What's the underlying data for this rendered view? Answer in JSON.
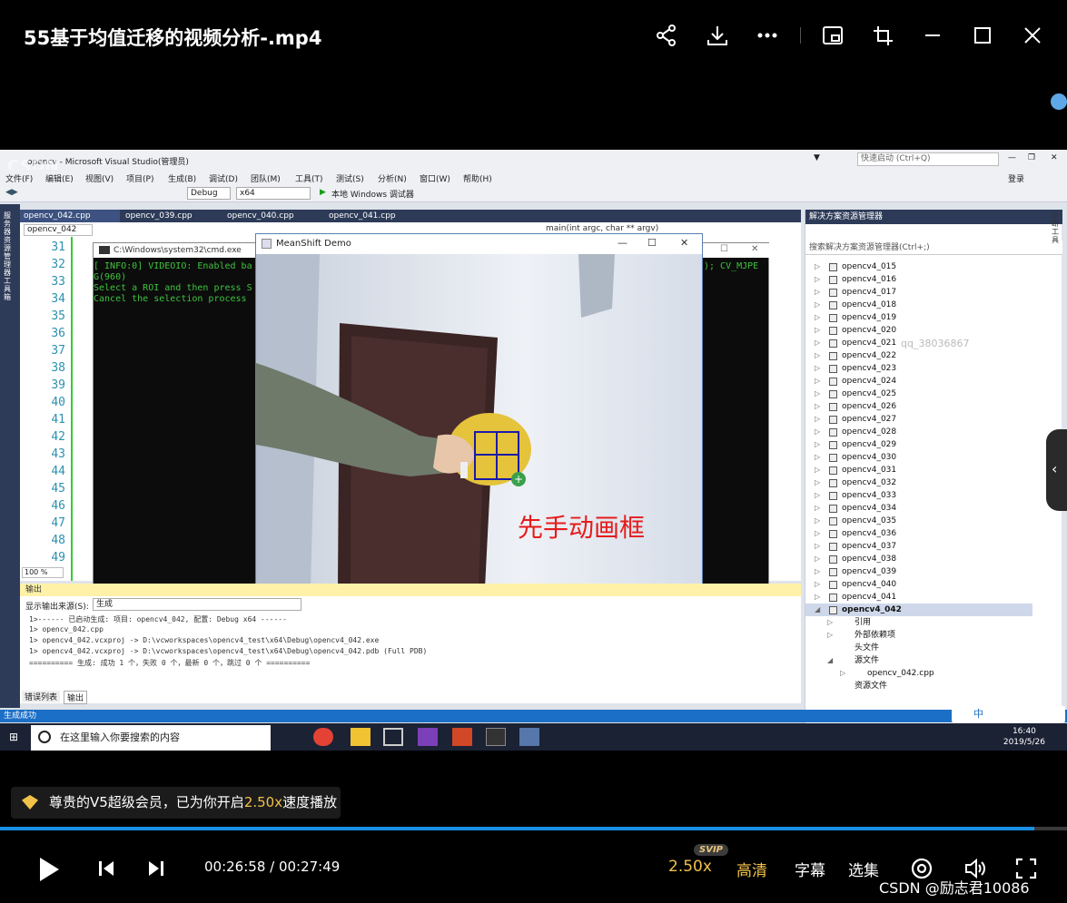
{
  "player": {
    "title": "55基于均值迁移的视频分析-.mp4",
    "vip_prefix": "尊贵的V5超级会员，已为你开启",
    "vip_speed": "2.50x",
    "vip_suffix": "速度播放",
    "time": "00:26:58 / 00:27:49",
    "progress": 0.969,
    "speed": "2.50x",
    "svip_badge": "SVIP",
    "quality": "高清",
    "subtitles": "字幕",
    "episodes": "选集",
    "watermark": "CSDN @励志君10086",
    "icons": [
      "share-icon",
      "download-icon",
      "more-icon",
      "pip-icon",
      "crop-icon",
      "minimize-icon",
      "maximize-icon",
      "close-icon",
      "play-icon",
      "prev-icon",
      "next-icon",
      "target-icon",
      "volume-icon",
      "fullscreen-icon"
    ]
  },
  "vs": {
    "title": "opencv - Microsoft Visual Studio(管理员)",
    "quick_launch": "快速启动 (Ctrl+Q)",
    "login": "登录",
    "menu": [
      "文件(F)",
      "编辑(E)",
      "视图(V)",
      "项目(P)",
      "生成(B)",
      "调试(D)",
      "团队(M)",
      "工具(T)",
      "测试(S)",
      "分析(N)",
      "窗口(W)",
      "帮助(H)"
    ],
    "config": "Debug",
    "platform": "x64",
    "run_label": "本地 Windows 调试器",
    "tabs": [
      "opencv_042.cpp",
      "opencv_039.cpp",
      "opencv_040.cpp",
      "opencv_041.cpp"
    ],
    "scope": "opencv_042",
    "func": "main(int argc, char ** argv)",
    "line_numbers": [
      "31",
      "32",
      "33",
      "34",
      "35",
      "36",
      "37",
      "38",
      "39",
      "40",
      "41",
      "42",
      "43",
      "44",
      "45",
      "46",
      "47",
      "48",
      "49"
    ],
    "zoom": "100 %",
    "cmd_title": "C:\\Windows\\system32\\cmd.exe",
    "cmd_lines": [
      "[ INFO:0] VIDEOIO: Enabled ba",
      "G(960)",
      "Select a ROI and then press S",
      "Cancel the selection process"
    ],
    "cmd_tail": "); CV_MJPE",
    "meanshift_title": "MeanShift Demo",
    "caption": "先手动画框",
    "output_title": "输出",
    "output_source_label": "显示输出来源(S):",
    "output_source": "生成",
    "output_lines": [
      "1>------ 已启动生成: 项目: opencv4_042, 配置: Debug x64 ------",
      "1>  opencv_042.cpp",
      "1>  opencv4_042.vcxproj -> D:\\vcworkspaces\\opencv4_test\\x64\\Debug\\opencv4_042.exe",
      "1>  opencv4_042.vcxproj -> D:\\vcworkspaces\\opencv4_test\\x64\\Debug\\opencv4_042.pdb (Full PDB)",
      "========== 生成: 成功 1 个，失败 0 个，最新 0 个，跳过 0 个 =========="
    ],
    "bottom_tabs": [
      "错误列表",
      "输出"
    ],
    "solution_title": "解决方案资源管理器",
    "solution_search": "搜索解决方案资源管理器(Ctrl+;)",
    "solution_items": [
      "opencv4_015",
      "opencv4_016",
      "opencv4_017",
      "opencv4_018",
      "opencv4_019",
      "opencv4_020",
      "opencv4_021",
      "opencv4_022",
      "opencv4_023",
      "opencv4_024",
      "opencv4_025",
      "opencv4_026",
      "opencv4_027",
      "opencv4_028",
      "opencv4_029",
      "opencv4_030",
      "opencv4_031",
      "opencv4_032",
      "opencv4_033",
      "opencv4_034",
      "opencv4_035",
      "opencv4_036",
      "opencv4_037",
      "opencv4_038",
      "opencv4_039",
      "opencv4_040",
      "opencv4_041",
      "opencv4_042"
    ],
    "solution_children": [
      "引用",
      "外部依赖项",
      "头文件",
      "源文件",
      "opencv_042.cpp",
      "资源文件"
    ],
    "qq_watermark": "qq_38036867",
    "status": "生成成功",
    "side_tabs": "服务器资源管理器 工具箱",
    "right_side_tab": "诊断工具"
  },
  "taskbar": {
    "search_placeholder": "在这里输入你要搜索的内容",
    "time": "16:40",
    "date": "2019/5/26",
    "ime": "中"
  },
  "overlay": {
    "csdn_logo": "CSDN"
  }
}
